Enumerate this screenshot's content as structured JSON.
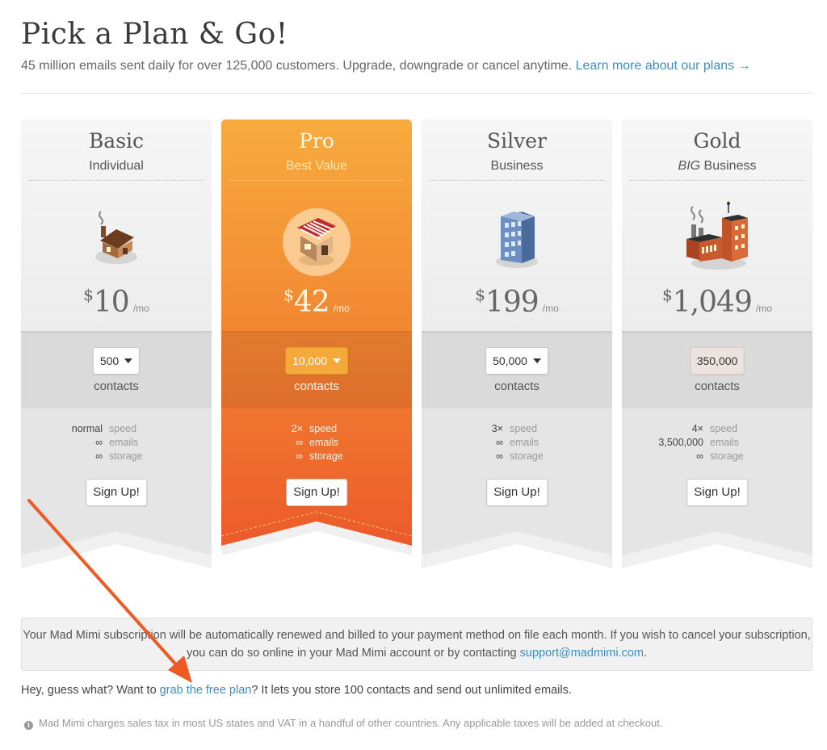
{
  "header": {
    "title": "Pick a Plan & Go!",
    "subtitle": "45 million emails sent daily for over 125,000 customers. Upgrade, downgrade or cancel anytime.",
    "learn_more_link": "Learn more about our plans →"
  },
  "plans": [
    {
      "name": "Basic",
      "tagline": "Individual",
      "currency": "$",
      "price": "10",
      "per": "/mo",
      "contacts_value": "500",
      "contacts_label": "contacts",
      "features": [
        {
          "value": "normal",
          "label": "speed"
        },
        {
          "value": "∞",
          "label": "emails"
        },
        {
          "value": "∞",
          "label": "storage"
        }
      ],
      "signup_label": "Sign Up!",
      "icon": "house-icon"
    },
    {
      "name": "Pro",
      "tagline": "Best Value",
      "currency": "$",
      "price": "42",
      "per": "/mo",
      "contacts_value": "10,000",
      "contacts_label": "contacts",
      "features": [
        {
          "value": "2×",
          "label": "speed"
        },
        {
          "value": "∞",
          "label": "emails"
        },
        {
          "value": "∞",
          "label": "storage"
        }
      ],
      "signup_label": "Sign Up!",
      "icon": "shop-icon"
    },
    {
      "name": "Silver",
      "tagline": "Business",
      "currency": "$",
      "price": "199",
      "per": "/mo",
      "contacts_value": "50,000",
      "contacts_label": "contacts",
      "features": [
        {
          "value": "3×",
          "label": "speed"
        },
        {
          "value": "∞",
          "label": "emails"
        },
        {
          "value": "∞",
          "label": "storage"
        }
      ],
      "signup_label": "Sign Up!",
      "icon": "office-building-icon"
    },
    {
      "name": "Gold",
      "tagline_emphasis": "BIG",
      "tagline": "Business",
      "currency": "$",
      "price": "1,049",
      "per": "/mo",
      "contacts_value": "350,000",
      "contacts_label": "contacts",
      "features": [
        {
          "value": "4×",
          "label": "speed"
        },
        {
          "value": "3,500,000",
          "label": "emails"
        },
        {
          "value": "∞",
          "label": "storage"
        }
      ],
      "signup_label": "Sign Up!",
      "icon": "factory-icon"
    }
  ],
  "notice": {
    "text": "Your Mad Mimi subscription will be automatically renewed and billed to your payment method on file each month. If you wish to cancel your subscription, you can do so online in your Mad Mimi account or by contacting",
    "email_link": "support@madmimi.com",
    "end": "."
  },
  "free_plan": {
    "prefix": "Hey, guess what? Want to",
    "link": "grab the free plan",
    "suffix": "? It lets you store 100 contacts and send out unlimited emails."
  },
  "tax_note": {
    "icon": "info-icon",
    "text": "Mad Mimi charges sales tax in most US states and VAT in a handful of other countries. Any applicable taxes will be added at checkout."
  },
  "colors": {
    "link": "#3d8fc2",
    "pro_orange_top": "#f7a93c",
    "pro_orange_bottom": "#ee5b2a",
    "arrow": "#ee5a24"
  }
}
